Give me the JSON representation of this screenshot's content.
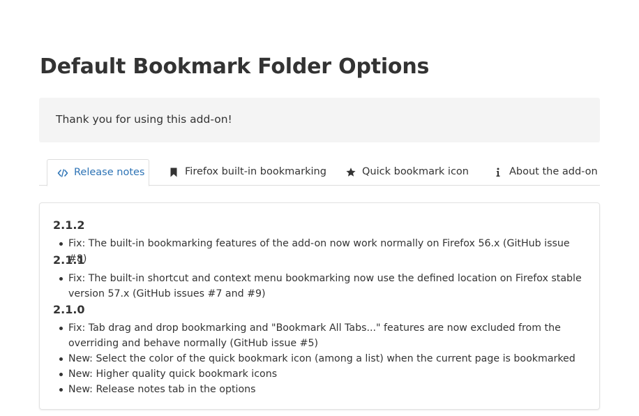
{
  "page": {
    "title": "Default Bookmark Folder Options"
  },
  "thanks": {
    "text": "Thank you for using this add-on!"
  },
  "tabs": [
    {
      "label": "Release notes",
      "icon": "code-icon",
      "active": true
    },
    {
      "label": "Firefox built-in bookmarking",
      "icon": "bookmark-icon",
      "active": false
    },
    {
      "label": "Quick bookmark icon",
      "icon": "star-icon",
      "active": false
    },
    {
      "label": "About the add-on",
      "icon": "info-icon",
      "active": false
    }
  ],
  "release_notes": [
    {
      "version": "2.1.2",
      "items": [
        "Fix: The built-in bookmarking features of the add-on now work normally on Firefox 56.x (GitHub issue #8)"
      ]
    },
    {
      "version": "2.1.1",
      "items": [
        "Fix: The built-in shortcut and context menu bookmarking now use the defined location on Firefox stable version 57.x (GitHub issues #7 and #9)"
      ]
    },
    {
      "version": "2.1.0",
      "items": [
        "Fix: Tab drag and drop bookmarking and \"Bookmark All Tabs...\" features are now excluded from the overriding and behave normally (GitHub issue #5)",
        "New: Select the color of the quick bookmark icon (among a list) when the current page is bookmarked",
        "New: Higher quality quick bookmark icons",
        "New: Release notes tab in the options"
      ]
    }
  ],
  "colors": {
    "active_tab": "#2d73b5",
    "text": "#333333",
    "box_background": "#f4f4f4",
    "border": "#dddddd"
  }
}
